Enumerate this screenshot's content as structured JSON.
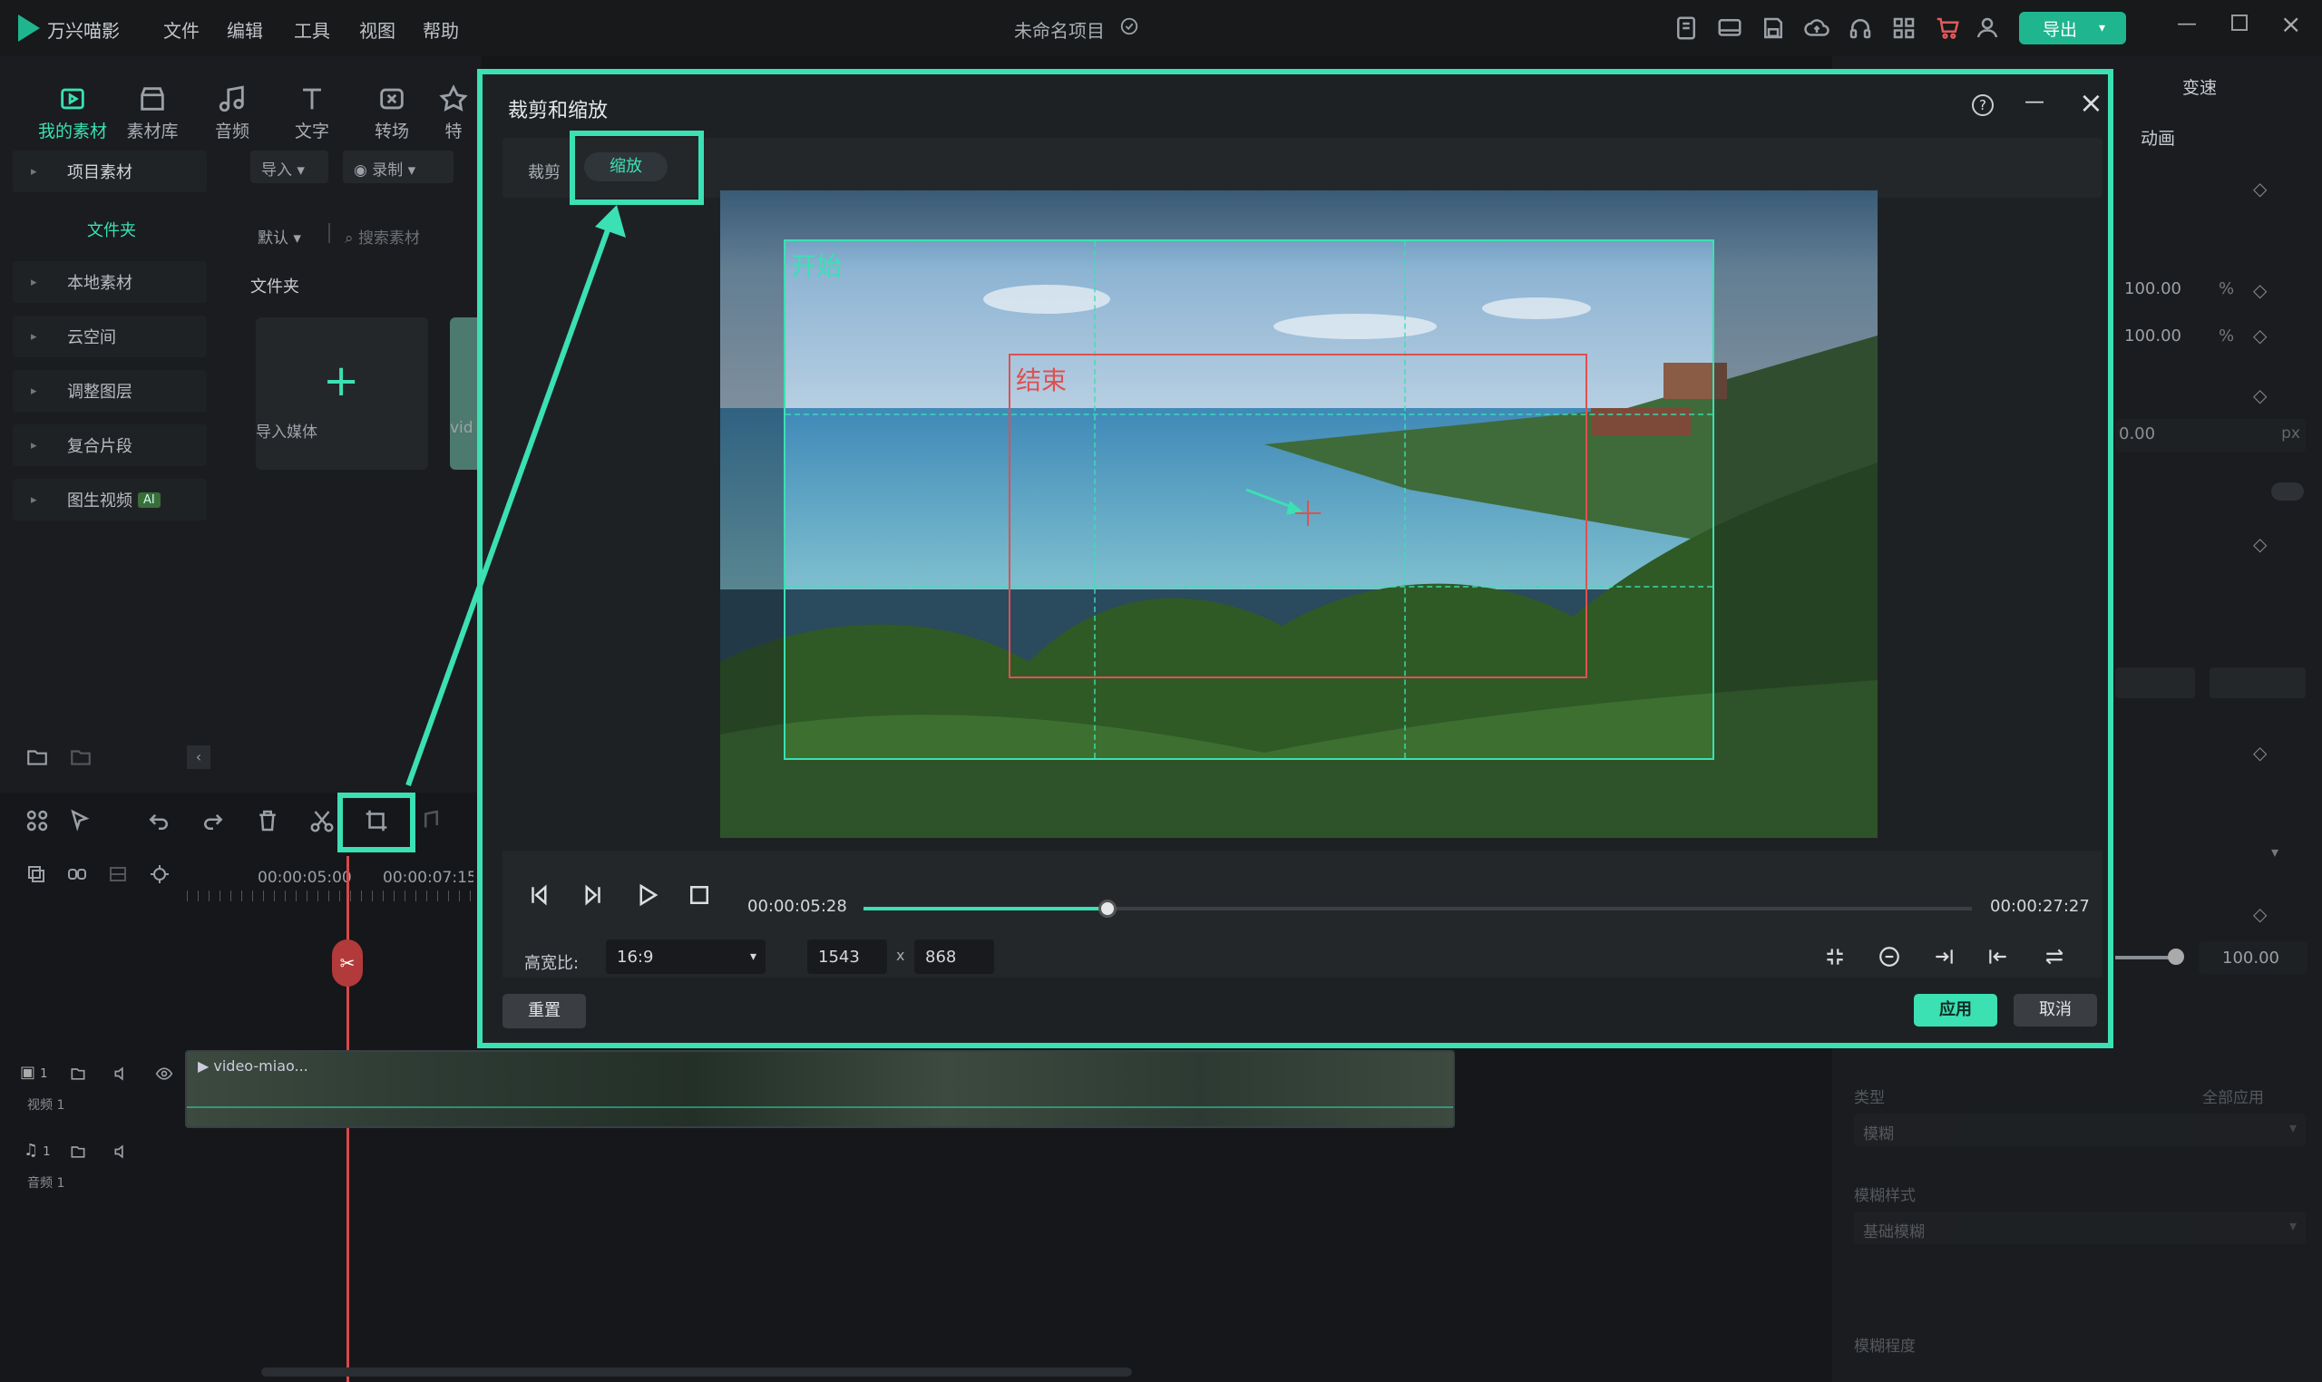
{
  "app": {
    "name": "万兴喵影",
    "project_title": "未命名项目",
    "menu": [
      "文件",
      "编辑",
      "工具",
      "视图",
      "帮助"
    ],
    "export_label": "导出"
  },
  "left_panel": {
    "tool_tabs": [
      "我的素材",
      "素材库",
      "音频",
      "文字",
      "转场",
      "特"
    ],
    "import_label": "导入",
    "record_label": "录制",
    "sort_label": "默认",
    "search_placeholder": "搜索素材",
    "folder_header": "文件夹",
    "import_media_label": "导入媒体",
    "media_item_label": "vid",
    "sidebar": [
      "项目素材",
      "文件夹",
      "本地素材",
      "云空间",
      "调整图层",
      "复合片段",
      "图生视频"
    ],
    "ai_badge": "AI"
  },
  "timeline": {
    "time_marks": [
      "00:00:05:00",
      "00:00:07:15"
    ],
    "video_clip_label": "video-miao...",
    "video_track_label": "视频 1",
    "audio_track_label": "音频 1",
    "video_track_count": "1",
    "audio_track_count": "1"
  },
  "right_panel": {
    "speed_tab": "变速",
    "animation_tab": "动画",
    "scale_x": "100.00",
    "scale_y": "100.00",
    "percent_unit": "%",
    "position_value": "0.00",
    "px_unit": "px",
    "opacity_value": "100.00",
    "type_label": "类型",
    "apply_all_label": "全部应用",
    "blur_label": "模糊",
    "blur_style_label": "模糊样式",
    "blur_style_value": "基础模糊",
    "blur_strength_label": "模糊程度",
    "reset_label": "重置"
  },
  "dialog": {
    "title": "裁剪和缩放",
    "tabs": [
      "裁剪",
      "缩放"
    ],
    "active_tab": "缩放",
    "start_label": "开始",
    "end_label": "结束",
    "current_time": "00:00:05:28",
    "total_time": "00:00:27:27",
    "progress": 0.22,
    "aspect_label": "高宽比:",
    "aspect_value": "16:9",
    "width_value": "1543",
    "height_value": "868",
    "times_sign": "x",
    "reset_label": "重置",
    "apply_label": "应用",
    "cancel_label": "取消"
  },
  "colors": {
    "accent": "#3be0b3",
    "brand_green": "#1fb58e",
    "end_rect": "#e05050",
    "playhead": "#d94848"
  }
}
